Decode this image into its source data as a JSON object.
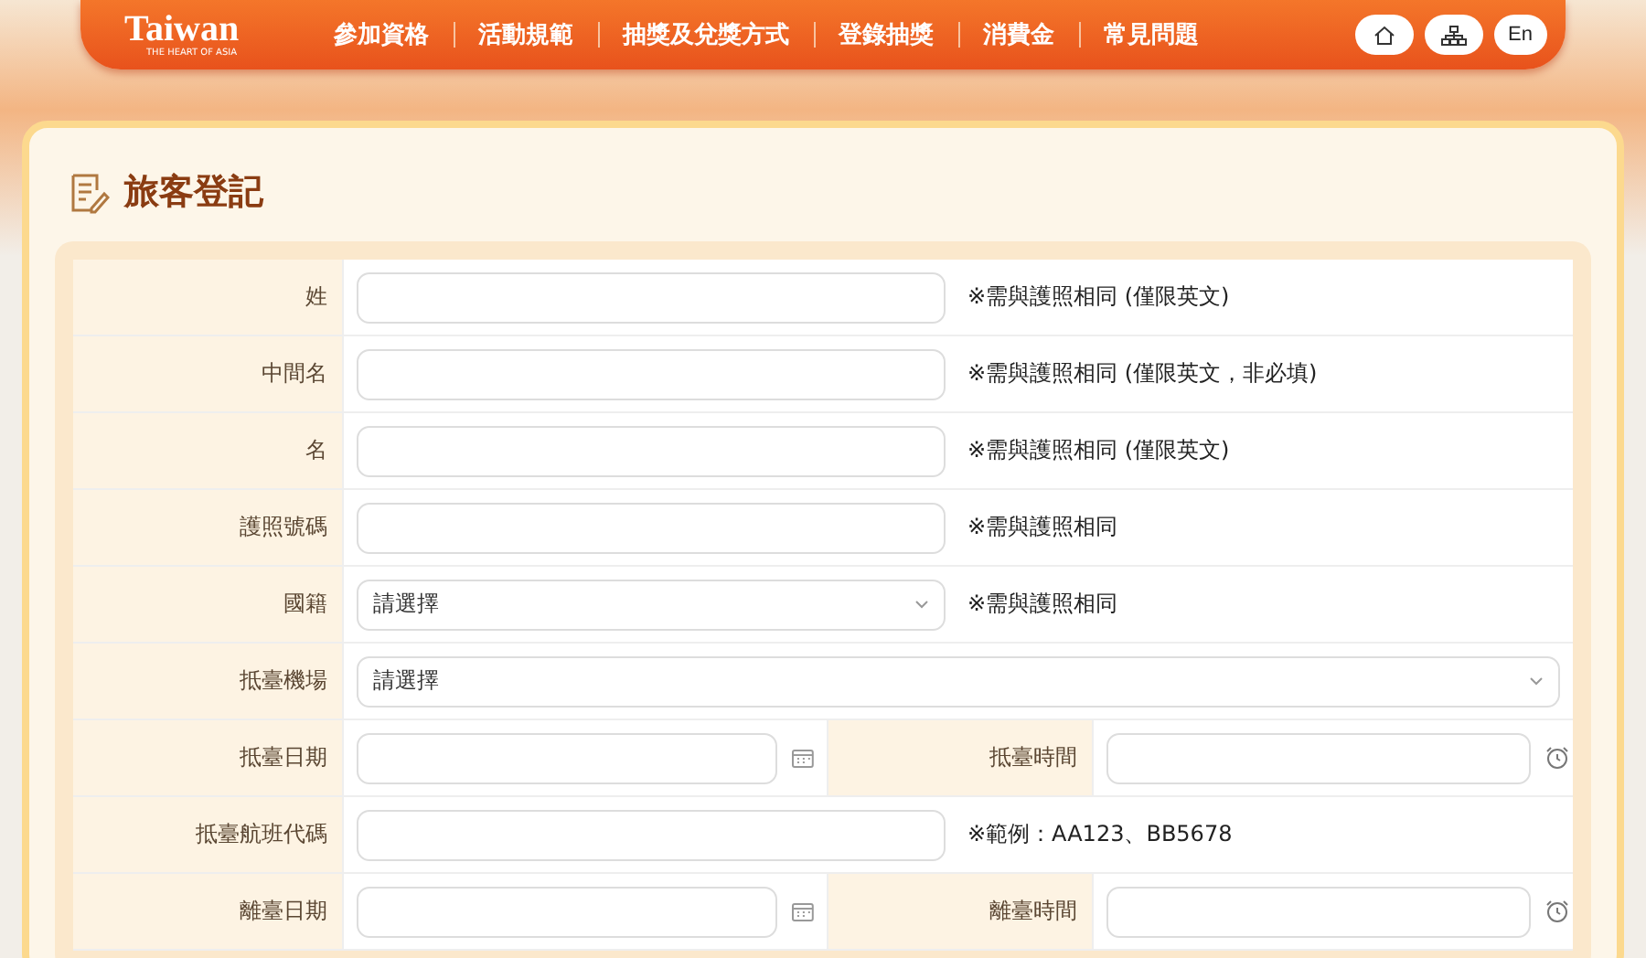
{
  "header": {
    "logo": "Taiwan",
    "tagline": "THE HEART OF ASIA",
    "nav": [
      "參加資格",
      "活動規範",
      "抽獎及兌獎方式",
      "登錄抽獎",
      "消費金",
      "常見問題"
    ],
    "language": "En"
  },
  "page": {
    "title": "旅客登記"
  },
  "form": {
    "rows": [
      {
        "kind": "text",
        "label": "姓",
        "note": "※需與護照相同 (僅限英文)"
      },
      {
        "kind": "text",
        "label": "中間名",
        "note": "※需與護照相同 (僅限英文，非必填)"
      },
      {
        "kind": "text",
        "label": "名",
        "note": "※需與護照相同 (僅限英文)"
      },
      {
        "kind": "text",
        "label": "護照號碼",
        "note": "※需與護照相同"
      },
      {
        "kind": "select",
        "label": "國籍",
        "placeholder": "請選擇",
        "note": "※需與護照相同"
      },
      {
        "kind": "select-wide",
        "label": "抵臺機場",
        "placeholder": "請選擇"
      },
      {
        "kind": "datetime",
        "label": "抵臺日期",
        "label_2": "抵臺時間"
      },
      {
        "kind": "text",
        "label": "抵臺航班代碼",
        "note": "※範例：AA123、BB5678"
      },
      {
        "kind": "datetime",
        "label": "離臺日期",
        "label_2": "離臺時間"
      }
    ]
  }
}
